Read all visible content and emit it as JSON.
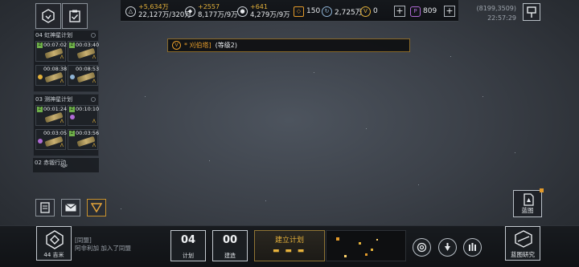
{
  "resources": {
    "r1": {
      "delta": "+5,634万",
      "amount": "22,127万/320万"
    },
    "r2": {
      "delta": "+2557",
      "amount": "8,177万/9万"
    },
    "r3": {
      "delta": "+641",
      "amount": "4,279万/9万"
    },
    "energy": "150",
    "cycle": "2,725万",
    "token": "0",
    "premium": "809",
    "plus": "+"
  },
  "coords": {
    "position": "(8199,3509)",
    "clock": "22:57:29"
  },
  "plan_panels": [
    {
      "title": "04 虹神星计划",
      "slots": [
        "00:07:02",
        "00:03:40",
        "00:08:38",
        "00:08:53"
      ]
    },
    {
      "title": "03 测神星计划",
      "slots": [
        "00:01:24",
        "00:10:10",
        "00:03:05",
        "00:03:56"
      ]
    }
  ],
  "mission": {
    "title": "02 赤锻行动"
  },
  "banner": {
    "icon": "V",
    "name": "* 刈伯塔]",
    "level": "(等级2)"
  },
  "blueprint": {
    "label": "蓝图"
  },
  "planet": {
    "distance": "44 吉米"
  },
  "chat": {
    "line1": "[同盟]",
    "line2": "阿非利加 加入了同盟"
  },
  "counters": [
    {
      "num": "04",
      "label": "计划"
    },
    {
      "num": "00",
      "label": "建造"
    }
  ],
  "build_plan": {
    "label": "建立计划",
    "dashes": "▬ ▬ ▬"
  },
  "blueprint_research": {
    "label": "蓝图研究"
  }
}
